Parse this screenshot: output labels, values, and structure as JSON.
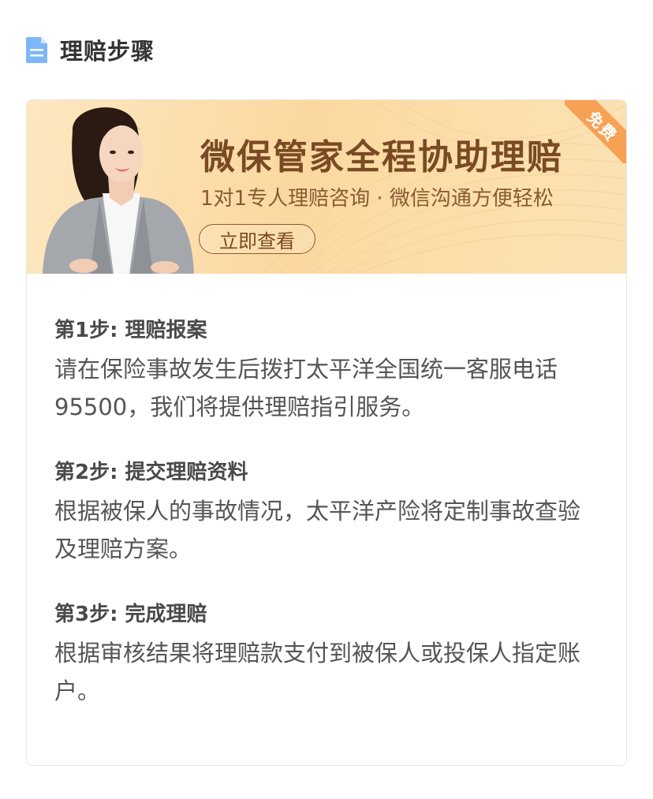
{
  "section": {
    "icon": "document-icon",
    "title": "理赔步骤"
  },
  "banner": {
    "title": "微保管家全程协助理赔",
    "subtitle": "1对1专人理赔咨询 · 微信沟通方便轻松",
    "button_label": "立即查看",
    "ribbon_label": "免费",
    "colors": {
      "background": "#fbd8a0",
      "text": "#7a4a25",
      "ribbon": "#f7a155"
    }
  },
  "steps": [
    {
      "title": "第1步: 理赔报案",
      "description": "请在保险事故发生后拨打太平洋全国统一客服电话95500，我们将提供理赔指引服务。"
    },
    {
      "title": "第2步: 提交理赔资料",
      "description": "根据被保人的事故情况，太平洋产险将定制事故查验及理赔方案。"
    },
    {
      "title": "第3步: 完成理赔",
      "description": "根据审核结果将理赔款支付到被保人或投保人指定账户。"
    }
  ]
}
